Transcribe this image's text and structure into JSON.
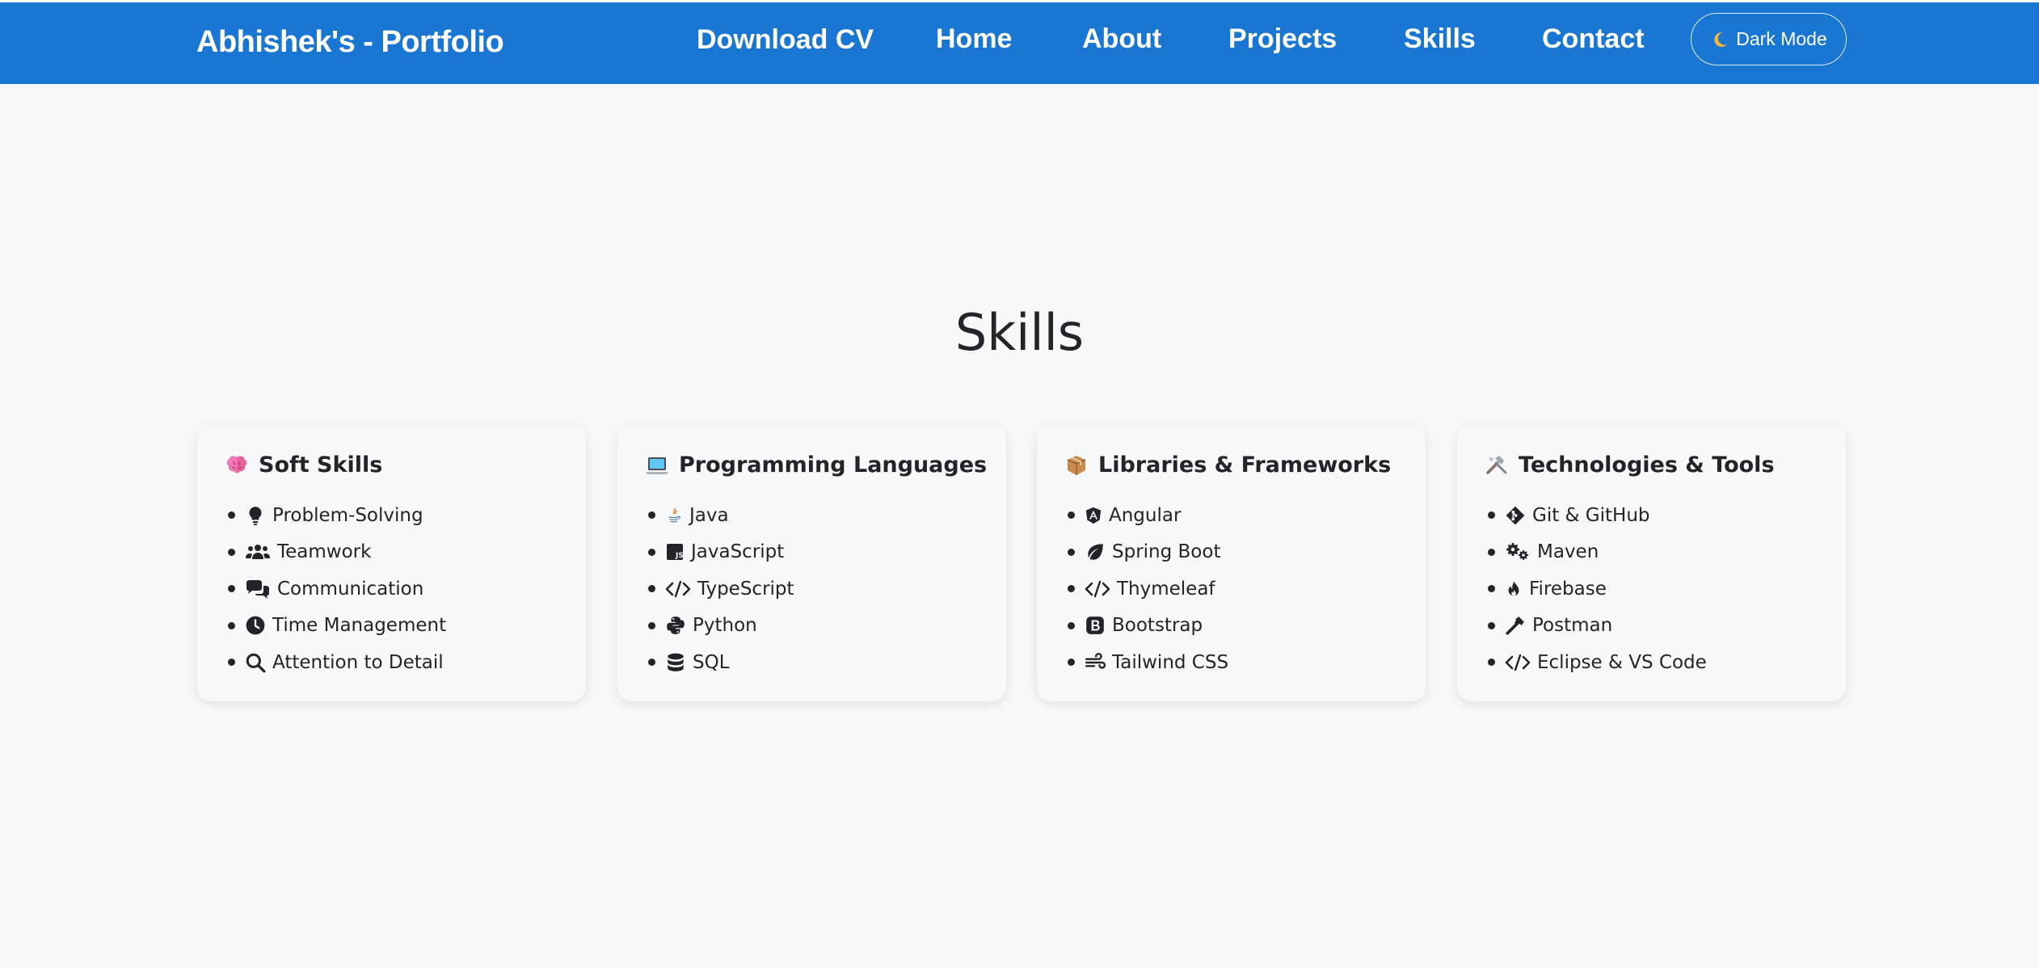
{
  "navbar": {
    "brand": "Abhishek's - Portfolio",
    "links": [
      "Download CV",
      "Home",
      "About",
      "Projects",
      "Skills",
      "Contact"
    ],
    "dark_mode_label": "Dark Mode",
    "dark_mode_icon": "moon-icon"
  },
  "colors": {
    "nav_bg": "#1976d2",
    "page_bg": "#f7f8fa",
    "text": "#212529"
  },
  "skills": {
    "title": "Skills",
    "cards": [
      {
        "heading": "Soft Skills",
        "icon": "brain-icon",
        "items": [
          {
            "label": "Problem-Solving",
            "icon": "lightbulb-icon"
          },
          {
            "label": "Teamwork",
            "icon": "users-icon"
          },
          {
            "label": "Communication",
            "icon": "comments-icon"
          },
          {
            "label": "Time Management",
            "icon": "clock-icon"
          },
          {
            "label": "Attention to Detail",
            "icon": "search-icon"
          }
        ]
      },
      {
        "heading": "Programming Languages",
        "icon": "laptop-icon",
        "items": [
          {
            "label": "Java",
            "icon": "java-icon"
          },
          {
            "label": "JavaScript",
            "icon": "javascript-icon"
          },
          {
            "label": "TypeScript",
            "icon": "code-icon"
          },
          {
            "label": "Python",
            "icon": "python-icon"
          },
          {
            "label": "SQL",
            "icon": "database-icon"
          }
        ]
      },
      {
        "heading": "Libraries & Frameworks",
        "icon": "package-icon",
        "items": [
          {
            "label": "Angular",
            "icon": "angular-icon"
          },
          {
            "label": "Spring Boot",
            "icon": "leaf-icon"
          },
          {
            "label": "Thymeleaf",
            "icon": "code-icon"
          },
          {
            "label": "Bootstrap",
            "icon": "bootstrap-icon"
          },
          {
            "label": "Tailwind CSS",
            "icon": "wind-icon"
          }
        ]
      },
      {
        "heading": "Technologies & Tools",
        "icon": "tools-icon",
        "items": [
          {
            "label": "Git & GitHub",
            "icon": "git-icon"
          },
          {
            "label": "Maven",
            "icon": "gears-icon"
          },
          {
            "label": "Firebase",
            "icon": "fire-icon"
          },
          {
            "label": "Postman",
            "icon": "hammer-icon"
          },
          {
            "label": "Eclipse & VS Code",
            "icon": "code-icon"
          }
        ]
      }
    ]
  }
}
